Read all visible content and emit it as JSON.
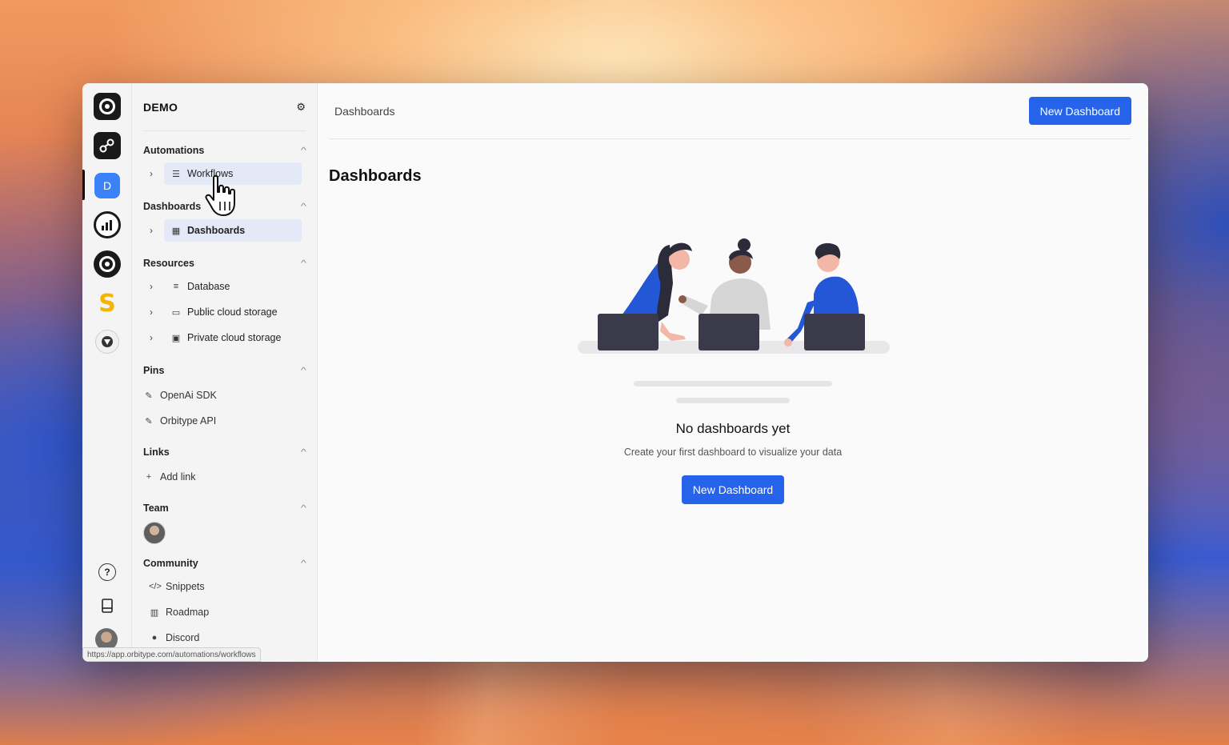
{
  "workspace": {
    "name": "DEMO"
  },
  "rail": {
    "active_app_letter": "D"
  },
  "sidebar": {
    "sections": [
      {
        "label": "Automations",
        "items": [
          {
            "label": "Workflows",
            "icon": "list-icon"
          }
        ]
      },
      {
        "label": "Dashboards",
        "items": [
          {
            "label": "Dashboards",
            "icon": "grid-icon"
          }
        ]
      },
      {
        "label": "Resources",
        "items": [
          {
            "label": "Database",
            "icon": "database-icon"
          },
          {
            "label": "Public cloud storage",
            "icon": "folder-cloud-icon"
          },
          {
            "label": "Private cloud storage",
            "icon": "folder-lock-icon"
          }
        ]
      },
      {
        "label": "Pins",
        "items": [
          {
            "label": "OpenAi SDK",
            "icon": "pin-icon"
          },
          {
            "label": "Orbitype API",
            "icon": "pin-icon"
          }
        ]
      },
      {
        "label": "Links",
        "items": [
          {
            "label": "Add link",
            "icon": "plus-icon"
          }
        ]
      },
      {
        "label": "Team"
      },
      {
        "label": "Community",
        "items": [
          {
            "label": "Snippets",
            "icon": "code-icon"
          },
          {
            "label": "Roadmap",
            "icon": "map-icon"
          },
          {
            "label": "Discord",
            "icon": "discord-icon"
          }
        ]
      }
    ]
  },
  "status_url": "https://app.orbitype.com/automations/workflows",
  "header": {
    "breadcrumb": "Dashboards",
    "new_button": "New Dashboard"
  },
  "main": {
    "title": "Dashboards",
    "empty_title": "No dashboards yet",
    "empty_subtitle": "Create your first dashboard to visualize your data",
    "empty_button": "New Dashboard"
  },
  "colors": {
    "accent": "#2563eb",
    "active_bg": "#e4e9f7"
  }
}
